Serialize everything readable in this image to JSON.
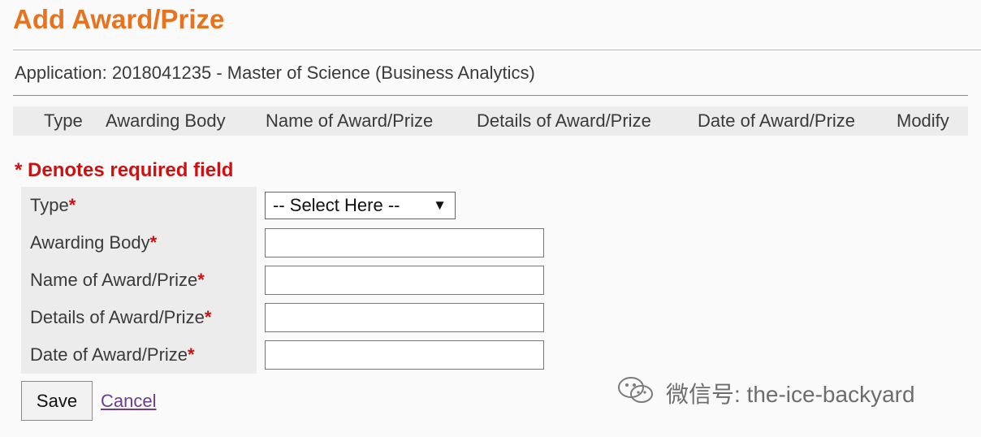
{
  "page": {
    "title": "Add Award/Prize",
    "application_line": "Application: 2018041235 - Master of Science (Business Analytics)"
  },
  "table": {
    "headers": [
      "Type",
      "Awarding Body",
      "Name of Award/Prize",
      "Details of Award/Prize",
      "Date of Award/Prize",
      "Modify"
    ]
  },
  "form": {
    "required_note": "* Denotes required field",
    "required_marker": "*",
    "fields": [
      {
        "label": "Type",
        "kind": "select",
        "value": "-- Select Here --"
      },
      {
        "label": "Awarding Body",
        "kind": "text",
        "value": ""
      },
      {
        "label": "Name of Award/Prize",
        "kind": "text",
        "value": ""
      },
      {
        "label": "Details of Award/Prize",
        "kind": "text",
        "value": ""
      },
      {
        "label": "Date of Award/Prize",
        "kind": "text",
        "value": ""
      }
    ],
    "select_arrow": "▼"
  },
  "actions": {
    "save_label": "Save",
    "cancel_label": "Cancel"
  },
  "watermark": {
    "text": "微信号: the-ice-backyard",
    "icon": "wechat-icon"
  },
  "colors": {
    "title": "#e8731f",
    "required": "#cc1111",
    "link": "#6a3e8c",
    "header_bg": "#ececec"
  }
}
